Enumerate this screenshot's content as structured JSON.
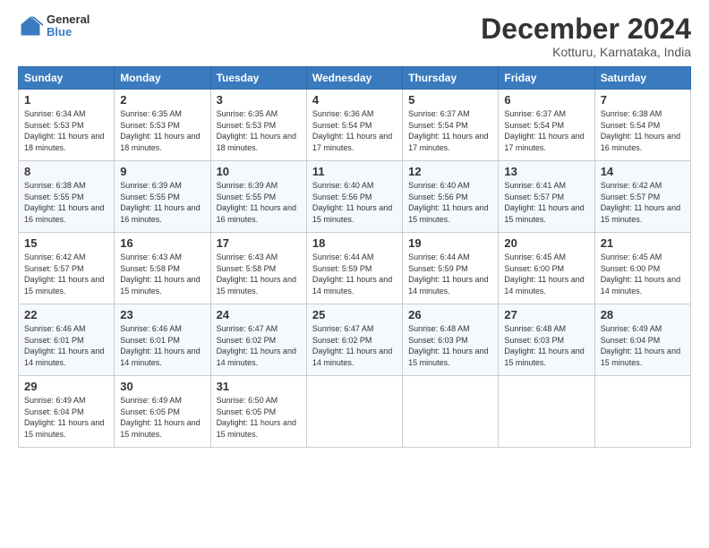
{
  "logo": {
    "general": "General",
    "blue": "Blue"
  },
  "title": "December 2024",
  "location": "Kotturu, Karnataka, India",
  "days_of_week": [
    "Sunday",
    "Monday",
    "Tuesday",
    "Wednesday",
    "Thursday",
    "Friday",
    "Saturday"
  ],
  "weeks": [
    [
      {
        "day": "1",
        "sunrise": "Sunrise: 6:34 AM",
        "sunset": "Sunset: 5:53 PM",
        "daylight": "Daylight: 11 hours and 18 minutes."
      },
      {
        "day": "2",
        "sunrise": "Sunrise: 6:35 AM",
        "sunset": "Sunset: 5:53 PM",
        "daylight": "Daylight: 11 hours and 18 minutes."
      },
      {
        "day": "3",
        "sunrise": "Sunrise: 6:35 AM",
        "sunset": "Sunset: 5:53 PM",
        "daylight": "Daylight: 11 hours and 18 minutes."
      },
      {
        "day": "4",
        "sunrise": "Sunrise: 6:36 AM",
        "sunset": "Sunset: 5:54 PM",
        "daylight": "Daylight: 11 hours and 17 minutes."
      },
      {
        "day": "5",
        "sunrise": "Sunrise: 6:37 AM",
        "sunset": "Sunset: 5:54 PM",
        "daylight": "Daylight: 11 hours and 17 minutes."
      },
      {
        "day": "6",
        "sunrise": "Sunrise: 6:37 AM",
        "sunset": "Sunset: 5:54 PM",
        "daylight": "Daylight: 11 hours and 17 minutes."
      },
      {
        "day": "7",
        "sunrise": "Sunrise: 6:38 AM",
        "sunset": "Sunset: 5:54 PM",
        "daylight": "Daylight: 11 hours and 16 minutes."
      }
    ],
    [
      {
        "day": "8",
        "sunrise": "Sunrise: 6:38 AM",
        "sunset": "Sunset: 5:55 PM",
        "daylight": "Daylight: 11 hours and 16 minutes."
      },
      {
        "day": "9",
        "sunrise": "Sunrise: 6:39 AM",
        "sunset": "Sunset: 5:55 PM",
        "daylight": "Daylight: 11 hours and 16 minutes."
      },
      {
        "day": "10",
        "sunrise": "Sunrise: 6:39 AM",
        "sunset": "Sunset: 5:55 PM",
        "daylight": "Daylight: 11 hours and 16 minutes."
      },
      {
        "day": "11",
        "sunrise": "Sunrise: 6:40 AM",
        "sunset": "Sunset: 5:56 PM",
        "daylight": "Daylight: 11 hours and 15 minutes."
      },
      {
        "day": "12",
        "sunrise": "Sunrise: 6:40 AM",
        "sunset": "Sunset: 5:56 PM",
        "daylight": "Daylight: 11 hours and 15 minutes."
      },
      {
        "day": "13",
        "sunrise": "Sunrise: 6:41 AM",
        "sunset": "Sunset: 5:57 PM",
        "daylight": "Daylight: 11 hours and 15 minutes."
      },
      {
        "day": "14",
        "sunrise": "Sunrise: 6:42 AM",
        "sunset": "Sunset: 5:57 PM",
        "daylight": "Daylight: 11 hours and 15 minutes."
      }
    ],
    [
      {
        "day": "15",
        "sunrise": "Sunrise: 6:42 AM",
        "sunset": "Sunset: 5:57 PM",
        "daylight": "Daylight: 11 hours and 15 minutes."
      },
      {
        "day": "16",
        "sunrise": "Sunrise: 6:43 AM",
        "sunset": "Sunset: 5:58 PM",
        "daylight": "Daylight: 11 hours and 15 minutes."
      },
      {
        "day": "17",
        "sunrise": "Sunrise: 6:43 AM",
        "sunset": "Sunset: 5:58 PM",
        "daylight": "Daylight: 11 hours and 15 minutes."
      },
      {
        "day": "18",
        "sunrise": "Sunrise: 6:44 AM",
        "sunset": "Sunset: 5:59 PM",
        "daylight": "Daylight: 11 hours and 14 minutes."
      },
      {
        "day": "19",
        "sunrise": "Sunrise: 6:44 AM",
        "sunset": "Sunset: 5:59 PM",
        "daylight": "Daylight: 11 hours and 14 minutes."
      },
      {
        "day": "20",
        "sunrise": "Sunrise: 6:45 AM",
        "sunset": "Sunset: 6:00 PM",
        "daylight": "Daylight: 11 hours and 14 minutes."
      },
      {
        "day": "21",
        "sunrise": "Sunrise: 6:45 AM",
        "sunset": "Sunset: 6:00 PM",
        "daylight": "Daylight: 11 hours and 14 minutes."
      }
    ],
    [
      {
        "day": "22",
        "sunrise": "Sunrise: 6:46 AM",
        "sunset": "Sunset: 6:01 PM",
        "daylight": "Daylight: 11 hours and 14 minutes."
      },
      {
        "day": "23",
        "sunrise": "Sunrise: 6:46 AM",
        "sunset": "Sunset: 6:01 PM",
        "daylight": "Daylight: 11 hours and 14 minutes."
      },
      {
        "day": "24",
        "sunrise": "Sunrise: 6:47 AM",
        "sunset": "Sunset: 6:02 PM",
        "daylight": "Daylight: 11 hours and 14 minutes."
      },
      {
        "day": "25",
        "sunrise": "Sunrise: 6:47 AM",
        "sunset": "Sunset: 6:02 PM",
        "daylight": "Daylight: 11 hours and 14 minutes."
      },
      {
        "day": "26",
        "sunrise": "Sunrise: 6:48 AM",
        "sunset": "Sunset: 6:03 PM",
        "daylight": "Daylight: 11 hours and 15 minutes."
      },
      {
        "day": "27",
        "sunrise": "Sunrise: 6:48 AM",
        "sunset": "Sunset: 6:03 PM",
        "daylight": "Daylight: 11 hours and 15 minutes."
      },
      {
        "day": "28",
        "sunrise": "Sunrise: 6:49 AM",
        "sunset": "Sunset: 6:04 PM",
        "daylight": "Daylight: 11 hours and 15 minutes."
      }
    ],
    [
      {
        "day": "29",
        "sunrise": "Sunrise: 6:49 AM",
        "sunset": "Sunset: 6:04 PM",
        "daylight": "Daylight: 11 hours and 15 minutes."
      },
      {
        "day": "30",
        "sunrise": "Sunrise: 6:49 AM",
        "sunset": "Sunset: 6:05 PM",
        "daylight": "Daylight: 11 hours and 15 minutes."
      },
      {
        "day": "31",
        "sunrise": "Sunrise: 6:50 AM",
        "sunset": "Sunset: 6:05 PM",
        "daylight": "Daylight: 11 hours and 15 minutes."
      },
      null,
      null,
      null,
      null
    ]
  ]
}
